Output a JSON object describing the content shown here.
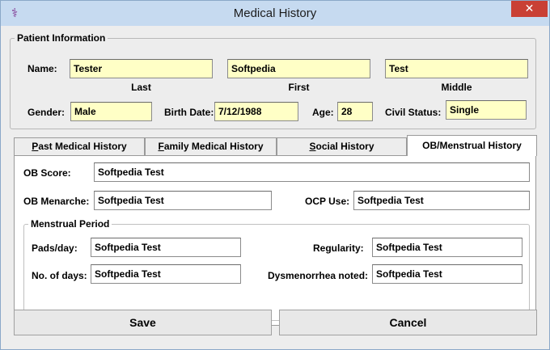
{
  "window": {
    "title": "Medical History",
    "icon": "caduceus-icon",
    "close_glyph": "✕"
  },
  "patient_info": {
    "legend": "Patient Information",
    "name_label": "Name:",
    "last_value": "Tester",
    "first_value": "Softpedia",
    "middle_value": "Test",
    "last_caption": "Last",
    "first_caption": "First",
    "middle_caption": "Middle",
    "gender_label": "Gender:",
    "gender_value": "Male",
    "birthdate_label": "Birth Date:",
    "birthdate_value": "7/12/1988",
    "age_label": "Age:",
    "age_value": "28",
    "civil_label": "Civil Status:",
    "civil_value": "Single"
  },
  "tabs": [
    {
      "label": "Past Medical History",
      "mnemonic": "P"
    },
    {
      "label": "Family Medical History",
      "mnemonic": "F"
    },
    {
      "label": "Social History",
      "mnemonic": "S"
    },
    {
      "label": "OB/Menstrual History",
      "active": true
    }
  ],
  "ob": {
    "ob_score_label": "OB Score:",
    "ob_score_value": "Softpedia Test",
    "menarche_label": "OB Menarche:",
    "menarche_value": "Softpedia Test",
    "ocp_label": "OCP Use:",
    "ocp_value": "Softpedia Test",
    "menstrual": {
      "legend": "Menstrual Period",
      "pads_label": "Pads/day:",
      "pads_value": "Softpedia Test",
      "regularity_label": "Regularity:",
      "regularity_value": "Softpedia Test",
      "days_label": "No. of days:",
      "days_value": "Softpedia Test",
      "dysmenorrhea_label": "Dysmenorrhea noted:",
      "dysmenorrhea_value": "Softpedia Test"
    }
  },
  "buttons": {
    "save": "Save",
    "cancel": "Cancel"
  },
  "colors": {
    "field_yellow": "#ffffc6",
    "titlebar": "#c6daf0",
    "close": "#c94035"
  }
}
